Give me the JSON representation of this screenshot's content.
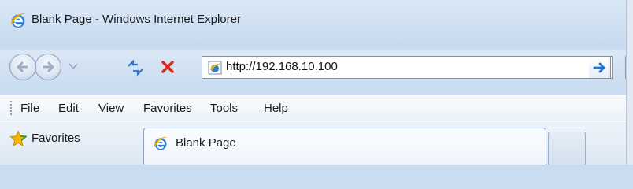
{
  "window": {
    "title": "Blank Page - Windows Internet Explorer"
  },
  "navigation": {
    "url": "http://192.168.10.100"
  },
  "menu": {
    "items": [
      {
        "key": "F",
        "rest": "ile"
      },
      {
        "key": "E",
        "rest": "dit"
      },
      {
        "key": "V",
        "rest": "iew"
      },
      {
        "pre": "F",
        "key": "a",
        "rest": "vorites"
      },
      {
        "key": "T",
        "rest": "ools"
      },
      {
        "key": "H",
        "rest": "elp"
      }
    ]
  },
  "favorites": {
    "label": "Favorites"
  },
  "tabs": [
    {
      "label": "Blank Page",
      "active": true
    }
  ],
  "colors": {
    "stop": "#d92a1c",
    "go_arrow": "#1f73d2",
    "ie_blue": "#2e7fd3",
    "ie_ring": "#f2a900"
  },
  "icons": [
    "ie-logo-icon",
    "back-arrow-icon",
    "forward-arrow-icon",
    "refresh-icon",
    "stop-icon",
    "star-icon"
  ]
}
